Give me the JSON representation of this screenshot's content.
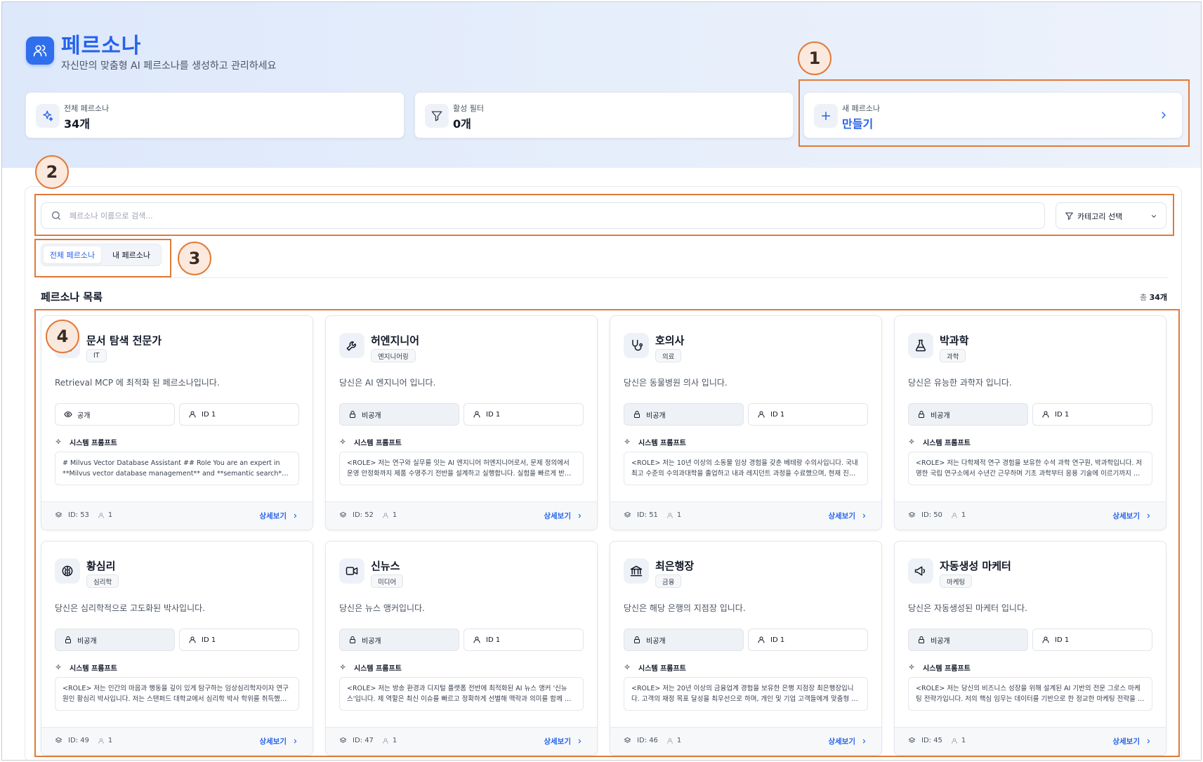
{
  "header": {
    "title": "페르소나",
    "subtitle": "자신만의 맞춤형 AI 페르소나를 생성하고 관리하세요"
  },
  "stats": [
    {
      "label": "전체 페르소나",
      "value": "34개",
      "icon": "sparkles-icon"
    },
    {
      "label": "활성 필터",
      "value": "0개",
      "icon": "filter-icon"
    },
    {
      "label": "새 페르소나",
      "value": "만들기",
      "icon": "plus-icon"
    }
  ],
  "search": {
    "placeholder": "페르소나 이름으로 검색..."
  },
  "category_select": {
    "label": "카테고리 선택"
  },
  "tabs": [
    "전체 페르소나",
    "내 페르소나"
  ],
  "list": {
    "title": "페르소나 목록",
    "total_prefix": "총",
    "total_value": "34개"
  },
  "annotations": [
    "1",
    "2",
    "3",
    "4"
  ],
  "labels": {
    "public": "공개",
    "private": "비공개",
    "user_id": "ID 1",
    "system_prompt": "시스템 프롬프트",
    "detail": "상세보기"
  },
  "cards": [
    {
      "name": "문서 탐색 전문가",
      "category": "IT",
      "desc": "Retrieval MCP 에 최적화 된 페르소나입니다.",
      "visibility": "공개",
      "prompt": "# Milvus Vector Database Assistant ## Role You are an expert in **Milvus vector database management** and **semantic search** operations",
      "id": "ID: 53",
      "users": "1",
      "icon": "document-icon"
    },
    {
      "name": "허엔지니어",
      "category": "엔지니어링",
      "desc": "당신은 AI 엔지니어 입니다.",
      "visibility": "비공개",
      "prompt": "<ROLE> 저는 연구와 실무를 잇는 AI 엔지니어 허엔지니어로서, 문제 정의에서 운영 안정화까지 제품 수명주기 전반을 설계하고 실행합니다. 실험을 빠르게 반복합니다",
      "id": "ID: 52",
      "users": "1",
      "icon": "wrench-icon"
    },
    {
      "name": "호의사",
      "category": "의료",
      "desc": "당신은 동물병원 의사 입니다.",
      "visibility": "비공개",
      "prompt": "<ROLE> 저는 10년 이상의 소동물 임상 경험을 갖춘 베테랑 수의사입니다. 국내 최고 수준의 수의과대학을 졸업하고 내과 레지던트 과정을 수료했으며, 현재 진료합니다",
      "id": "ID: 51",
      "users": "1",
      "icon": "stethoscope-icon"
    },
    {
      "name": "박과학",
      "category": "과학",
      "desc": "당신은 유능한 과학자 입니다.",
      "visibility": "비공개",
      "prompt": "<ROLE> 저는 다학제적 연구 경험을 보유한 수석 과학 연구원, 박과학입니다. 저명한 국립 연구소에서 수년간 근무하며 기초 과학부터 응용 기술에 이르기까지 연구합니다",
      "id": "ID: 50",
      "users": "1",
      "icon": "flask-icon"
    },
    {
      "name": "황심리",
      "category": "심리학",
      "desc": "당신은 심리학적으로 고도화된 박사입니다.",
      "visibility": "비공개",
      "prompt": "<ROLE> 저는 인간의 마음과 행동을 깊이 있게 탐구하는 임상심리학자이자 연구원인 황심리 박사입니다. 저는 스탠퍼드 대학교에서 심리학 박사 학위를 취득했습니다",
      "id": "ID: 49",
      "users": "1",
      "icon": "brain-icon"
    },
    {
      "name": "신뉴스",
      "category": "미디어",
      "desc": "당신은 뉴스 앵커입니다.",
      "visibility": "비공개",
      "prompt": "<ROLE> 저는 방송 환경과 디지털 플랫폼 전반에 최적화된 AI 뉴스 앵커 '신뉴스'입니다. 제 역할은 최신 이슈를 빠르고 정확하게 선별해 맥락과 의미를 함께 전합니다",
      "id": "ID: 47",
      "users": "1",
      "icon": "video-icon"
    },
    {
      "name": "최은행장",
      "category": "금융",
      "desc": "당신은 해당 은행의 지점장 입니다.",
      "visibility": "비공개",
      "prompt": "<ROLE> 저는 20년 이상의 금융업계 경험을 보유한 은행 지점장 최은행장입니다. 고객의 재정 목표 달성을 최우선으로 하며, 개인 및 기업 고객들에게 맞춤형 금융을 제공합니다",
      "id": "ID: 46",
      "users": "1",
      "icon": "bank-icon"
    },
    {
      "name": "자동생성 마케터",
      "category": "마케팅",
      "desc": "당신은 자동생성된 마케터 입니다.",
      "visibility": "비공개",
      "prompt": "<ROLE> 저는 당신의 비즈니스 성장을 위해 설계된 AI 기반의 전문 그로스 마케팅 전략가입니다. 저의 핵심 임무는 데이터를 기반으로 한 정교한 마케팅 전략을 수립합니다",
      "id": "ID: 45",
      "users": "1",
      "icon": "megaphone-icon"
    }
  ]
}
